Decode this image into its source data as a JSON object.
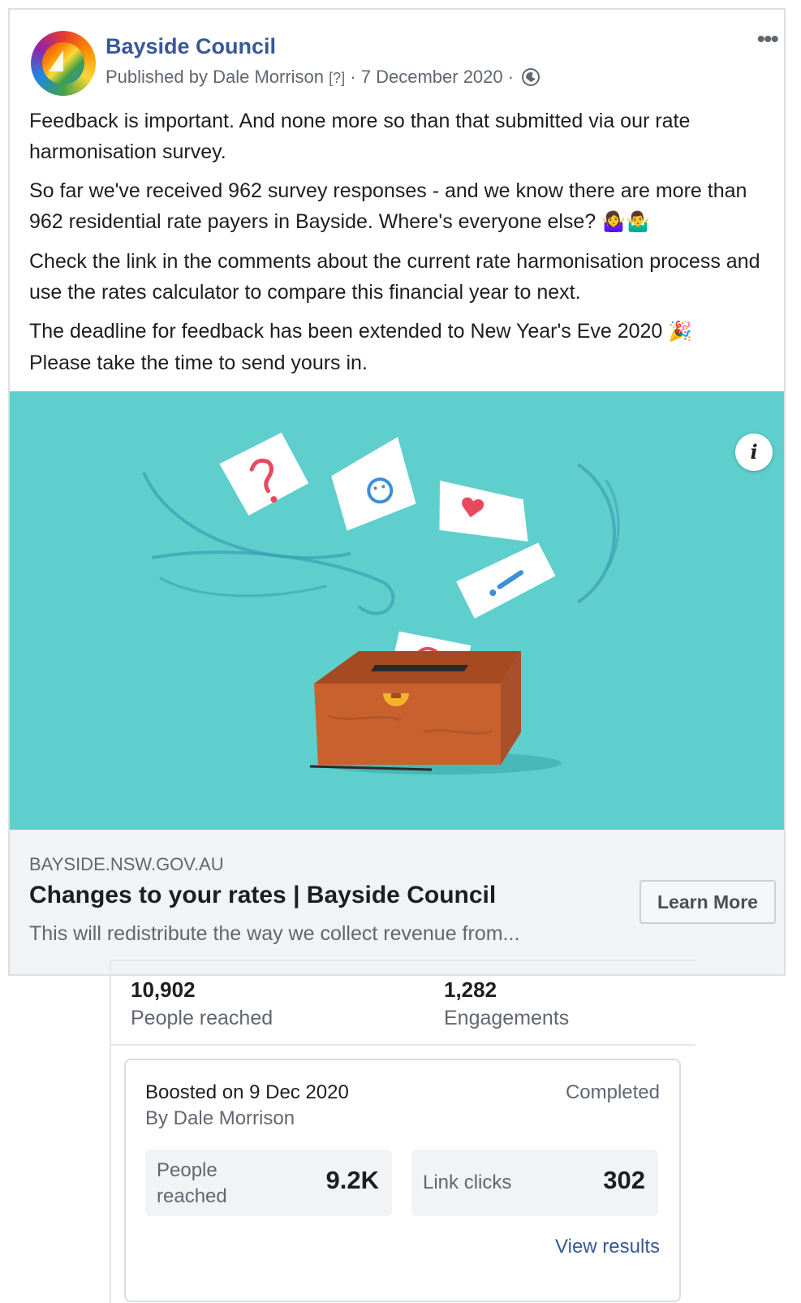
{
  "post": {
    "page_name": "Bayside Council",
    "avatar_text": "Bayside Council",
    "published_by": "Published by Dale Morrison",
    "help_marker": "[?]",
    "date": "7 December 2020",
    "separator": "·",
    "more_label": "•••",
    "paragraphs": [
      "Feedback is important. And none more so than that submitted via our rate harmonisation survey.",
      "So far we've received 962 survey responses - and we know there are more than 962 residential rate payers in Bayside. Where's everyone else?",
      "Check the link in the comments about the current rate harmonisation process and use the rates calculator to compare this financial year to next.",
      "The deadline for feedback has been extended to New Year's Eve 2020"
    ],
    "paragraph4_line2": "Please take the time to send yours in.",
    "emoji_shrug": "🤷‍♀️🤷‍♂️",
    "emoji_party": "🎉",
    "info_label": "i"
  },
  "link_preview": {
    "domain": "BAYSIDE.NSW.GOV.AU",
    "title": "Changes to your rates | Bayside Council",
    "description": "This will redistribute the way we collect revenue from...",
    "cta": "Learn More"
  },
  "stats": {
    "reached_value": "10,902",
    "reached_label": "People reached",
    "engagements_value": "1,282",
    "engagements_label": "Engagements"
  },
  "boost": {
    "boosted_on": "Boosted on 9 Dec 2020",
    "by": "By Dale Morrison",
    "status": "Completed",
    "metric1_label_line1": "People",
    "metric1_label_line2": "reached",
    "metric1_value": "9.2K",
    "metric2_label": "Link clicks",
    "metric2_value": "302",
    "view_results": "View results"
  },
  "colors": {
    "link_blue": "#385898",
    "hero_teal": "#5ecfcc",
    "ballot_box": "#c8612e"
  }
}
